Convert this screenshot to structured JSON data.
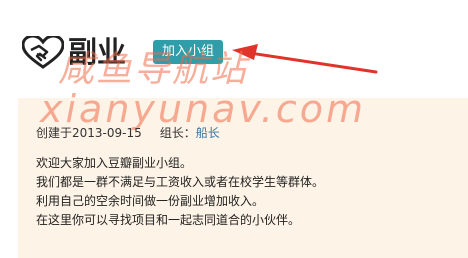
{
  "header": {
    "title": "副业",
    "join_label": "加入小组"
  },
  "watermark": {
    "cn": "咸鱼导航站",
    "en": "xianyunav.com"
  },
  "meta": {
    "created_label": "创建于",
    "created_date": "2013-09-15",
    "owner_label": "组长：",
    "owner_name": "船长"
  },
  "intro": {
    "lines": [
      "欢迎大家加入豆瓣副业小组。",
      "我们都是一群不满足与工资收入或者在校学生等群体。",
      "利用自己的空余时间做一份副业增加收入。",
      "在这里你可以寻找项目和一起志同道合的小伙伴。"
    ]
  },
  "colors": {
    "join_button": "#2f9ea8",
    "card_background": "#fdf3e6",
    "watermark": "#f06c48",
    "arrow": "#e0342b",
    "link": "#3377aa"
  },
  "icons": {
    "logo": "handshake-heart-icon",
    "annotation": "red-arrow"
  }
}
